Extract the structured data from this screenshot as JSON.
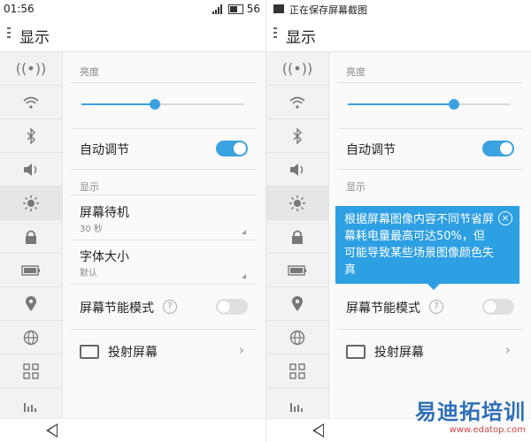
{
  "left": {
    "statusbar": {
      "time": "01:56",
      "battery": "56"
    },
    "toolbar": {
      "title": "显示"
    },
    "brightness_label": "亮度",
    "brightness_level": 0.45,
    "auto_adjust_label": "自动调节",
    "display_section_label": "显示",
    "screen_standby": {
      "label": "屏幕待机",
      "value": "30 秒"
    },
    "font_size": {
      "label": "字体大小",
      "value": "默认"
    },
    "power_saving": {
      "label": "屏幕节能模式"
    },
    "cast": {
      "label": "投射屏幕"
    }
  },
  "right": {
    "statusbar": {
      "message": "正在保存屏幕截图"
    },
    "toolbar": {
      "title": "显示"
    },
    "brightness_label": "亮度",
    "brightness_level": 0.65,
    "auto_adjust_label": "自动调节",
    "display_section_label": "显示",
    "power_saving": {
      "label": "屏幕节能模式"
    },
    "cast": {
      "label": "投射屏幕"
    },
    "tooltip": {
      "text": "根据屏幕图像内容不同节省屏幕耗电量最高可达50%，但可能导致某些场景图像颜色失真",
      "close": "×"
    }
  },
  "sidebar_icons": [
    "hotspot-icon",
    "wifi-icon",
    "bluetooth-icon",
    "volume-icon",
    "brightness-icon",
    "lock-icon",
    "battery-icon",
    "location-icon",
    "globe-icon",
    "apps-icon",
    "stats-icon"
  ],
  "watermark": {
    "brand": "易迪拓培训",
    "url": "www.edatop.com"
  },
  "colors": {
    "accent": "#3aa2e0",
    "tooltip": "#2d9fe3"
  }
}
